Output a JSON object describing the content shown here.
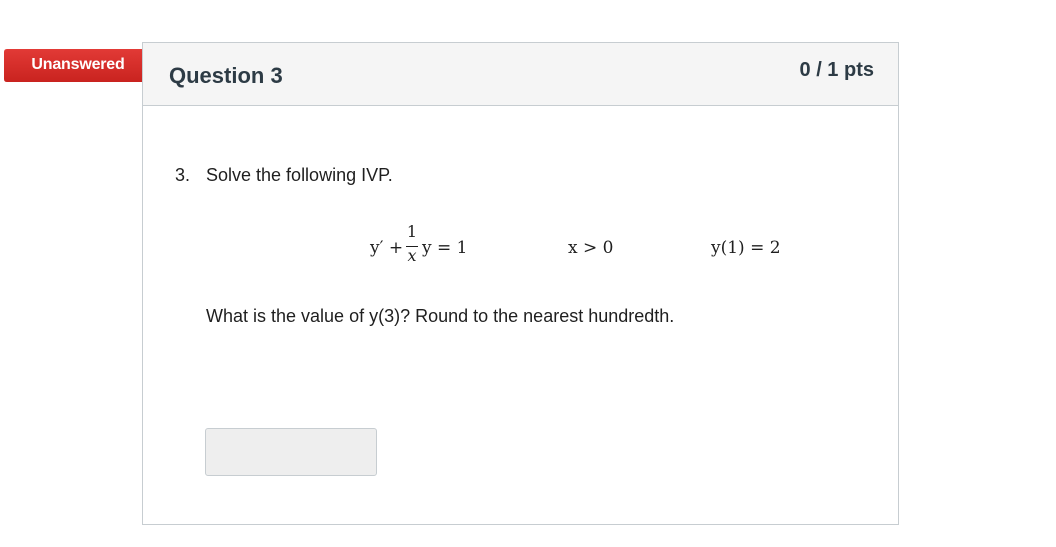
{
  "status_flag": {
    "label": "Unanswered",
    "color": "#d9302c"
  },
  "question": {
    "title": "Question 3",
    "points": "0 / 1 pts",
    "number": "3.",
    "prompt": "Solve the following IVP.",
    "equations": {
      "ode_lhs": "y′ +",
      "ode_frac_num": "1",
      "ode_frac_den": "x",
      "ode_rhs": "y = 1",
      "domain": "x > 0",
      "initial_condition": "y(1) = 2"
    },
    "ask": "What is the value of y(3)? Round to the nearest hundredth."
  },
  "answer": {
    "value": "",
    "placeholder": ""
  },
  "colors": {
    "header_bg": "#f5f5f5",
    "border": "#c7cdd1",
    "input_bg": "#eeeeee"
  }
}
